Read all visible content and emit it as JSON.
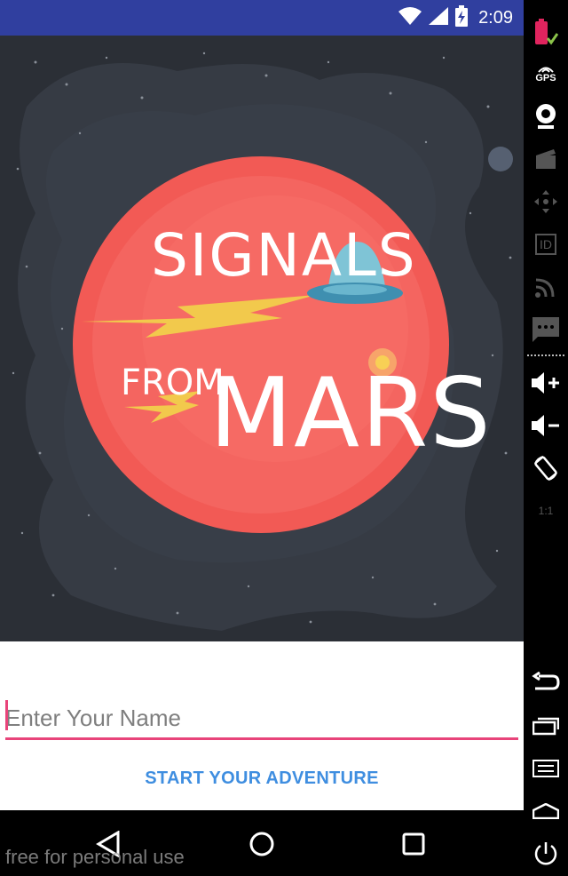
{
  "status_bar": {
    "time": "2:09",
    "icons": [
      "wifi-icon",
      "cell-signal-icon",
      "battery-charging-icon"
    ],
    "color": "#303F9F"
  },
  "hero": {
    "logo_line1": "SIGNALS",
    "logo_line2_small": "FROM",
    "logo_line2_big": "MARS",
    "background": "#2B2F36",
    "planet_color": "#F25A55"
  },
  "form": {
    "name_placeholder": "Enter Your Name",
    "name_value": "",
    "start_button_label": "START YOUR ADVENTURE",
    "accent": "#E8447A",
    "button_color": "#3F8EE0"
  },
  "nav_bar": {
    "buttons": [
      "back-icon",
      "home-icon",
      "recents-icon"
    ]
  },
  "watermark": "free for personal use",
  "emulator_toolbar": {
    "gps_label": "GPS",
    "id_label": "ID",
    "scale_label": "1:1",
    "icons": [
      "battery-icon",
      "gps-icon",
      "camera-icon",
      "video-icon",
      "dpad-icon",
      "id-icon",
      "cast-icon",
      "sms-icon",
      "volume-up-icon",
      "volume-down-icon",
      "rotate-icon",
      "scale-icon",
      "back-icon",
      "overview-icon",
      "menu-icon",
      "home-icon",
      "power-icon"
    ]
  }
}
